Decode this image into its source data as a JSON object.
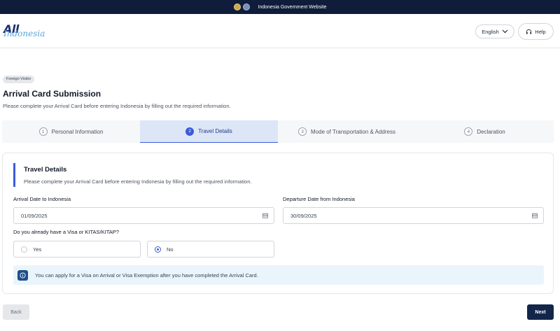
{
  "gov_bar": {
    "text": "Indonesia Government Website"
  },
  "header": {
    "logo_primary": "All",
    "logo_secondary": "Indonesia",
    "language": "English",
    "help_label": "Help"
  },
  "page": {
    "badge": "Foreign Visitor",
    "title": "Arrival Card Submission",
    "subtitle": "Please complete your Arrival Card before entering Indonesia by filling out the required information."
  },
  "steps": [
    {
      "number": "1",
      "label": "Personal Information",
      "active": false
    },
    {
      "number": "2",
      "label": "Travel Details",
      "active": true
    },
    {
      "number": "3",
      "label": "Mode of Transportation & Address",
      "active": false
    },
    {
      "number": "4",
      "label": "Declaration",
      "active": false
    }
  ],
  "travel": {
    "section_title": "Travel Details",
    "section_subtitle": "Please complete your Arrival Card before entering Indonesia by filling out the required information.",
    "arrival_label": "Arrival Date to Indonesia",
    "arrival_value": "01/09/2025",
    "departure_label": "Departure Date from Indonesia",
    "departure_value": "30/09/2025",
    "visa_question": "Do you already have a Visa or KITAS/KITAP?",
    "option_yes": "Yes",
    "option_no": "No",
    "selected_option": "No",
    "info_text": "You can apply for a Visa on Arrival or Visa Exemption after you have completed the Arrival Card."
  },
  "footer": {
    "back_label": "Back",
    "next_label": "Next"
  },
  "colors": {
    "accent": "#3b5bdb",
    "navy": "#13264a",
    "gov_bar": "#0f1c3a"
  }
}
